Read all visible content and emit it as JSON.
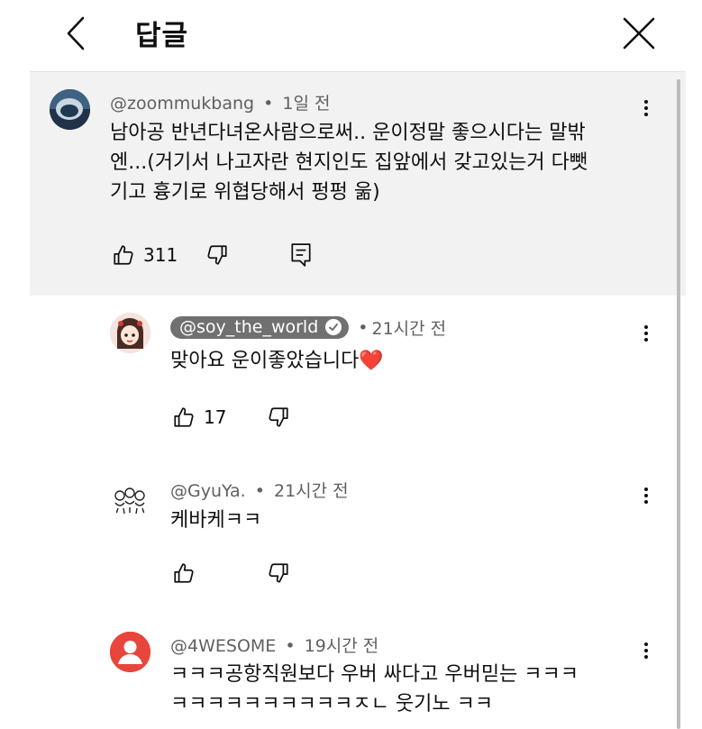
{
  "header": {
    "title": "답글"
  },
  "parent": {
    "author": "@zoommukbang",
    "time": "1일 전",
    "lines": [
      "남아공 반년다녀온사람으로써.. 운이정말 좋으시다는 말밖",
      "엔...(거기서 나고자란 현지인도 집앞에서 갖고있는거 다뺏",
      "기고 흉기로 위협당해서 펑펑 욺)"
    ],
    "likes": "311"
  },
  "replies": [
    {
      "author": "@soy_the_world",
      "time": "21시간 전",
      "lines": [
        "맞아요 운이좋았습니다❤️"
      ],
      "likes": "17"
    },
    {
      "author": "@GyuYa.",
      "time": "21시간 전",
      "lines": [
        "케바케ㅋㅋ"
      ],
      "likes": ""
    },
    {
      "author": "@4WESOME",
      "time": "19시간 전",
      "lines": [
        "ㅋㅋㅋ공항직원보다 우버 싸다고 우버믿는 ㅋㅋㅋ",
        "ㅋㅋㅋㅋㅋㅋㅋㅋㅋㅋㅈㄴ 웃기노 ㅋㅋ"
      ],
      "likes": ""
    }
  ],
  "separator": "•",
  "colors": {
    "parent_bg": "#f2f2f2",
    "avatar_red": "#e8453c",
    "chip_bg": "#707070",
    "heart": "#e0245e"
  }
}
